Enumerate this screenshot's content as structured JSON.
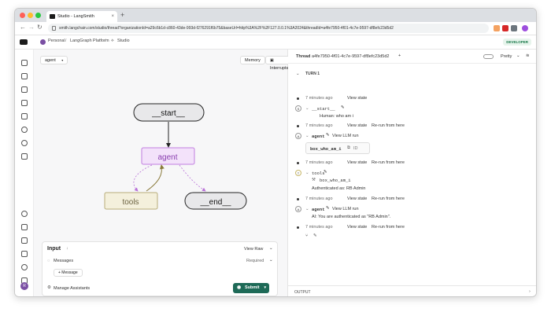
{
  "browser": {
    "tab_title": "Studio - LangSmith",
    "url": "smith.langchain.com/studio/thread?organizationId=a29c6b1d-c860-43de-993d-f276291f6b75&baseUrl=http%3A%2F%2F127.0.0.1%3A2024&threadId=a4fe7950-4f01-4c7e-9597-df8efc23d5d2"
  },
  "appbar": {
    "crumbs": [
      "Personal",
      "LangGraph Platform",
      "Studio"
    ],
    "badge": "DEVELOPER"
  },
  "graph_panel": {
    "graph_select": "agent",
    "memory_label": "Memory",
    "interrupts_label": "Interrupts",
    "nodes": {
      "start": "__start__",
      "agent": "agent",
      "tools": "tools",
      "end": "__end__"
    }
  },
  "input_panel": {
    "title": "Input",
    "view_raw": "View Raw",
    "messages_label": "Messages",
    "required_label": "Required",
    "add_message": "+ Message",
    "manage_assistants": "Manage Assistants",
    "submit": "Submit"
  },
  "thread_panel": {
    "thread_label": "Thread",
    "thread_id": "a4fe7950-4f01-4c7e-9597-df8efc23d5d2",
    "mode": "Pretty",
    "turn": "TURN 1",
    "timestamp": "7 minutes ago",
    "view_state": "View state",
    "rerun": "Re-run from here",
    "start_node": "__start__",
    "human_msg": "Human: who am i",
    "agent_node": "agent",
    "view_llm_run": "View LLM run",
    "tool_call": "box_who_am_i",
    "tool_call_id": "ID",
    "tools_node": "tools",
    "tool_name": "box_who_am_i",
    "tool_result": "Authenticated as: RB Admin",
    "ai_msg": "AI: You are authenticated as \"RB Admin\".",
    "output_label": "OUTPUT"
  },
  "colors": {
    "agent_fill": "#f3e2fa",
    "agent_border": "#c27fe0",
    "tools_fill": "#f4f0dc",
    "submit_bg": "#1e6a57"
  }
}
